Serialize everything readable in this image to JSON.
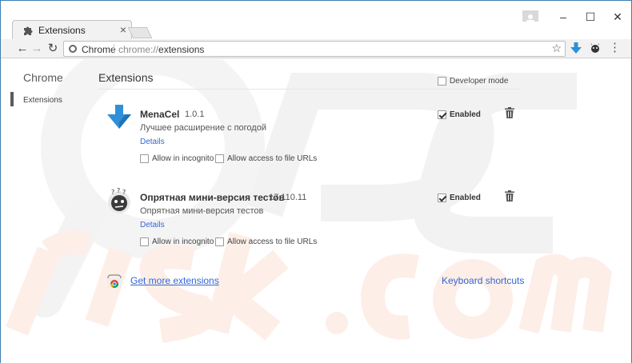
{
  "tab": {
    "title": "Extensions",
    "close": "×"
  },
  "window_controls": {
    "minimize": "–",
    "maximize": "☐",
    "close": "✕"
  },
  "toolbar": {
    "back": "←",
    "forward": "→",
    "reload": "↻",
    "chip_label": "Chrome",
    "url_scheme": "chrome://",
    "url_path": "extensions",
    "star": "☆",
    "menu": "⋮"
  },
  "sidebar": {
    "title": "Chrome",
    "items": [
      {
        "label": "Extensions"
      }
    ]
  },
  "main": {
    "title": "Extensions",
    "developer_mode_label": "Developer mode",
    "developer_mode_checked": false
  },
  "extensions": [
    {
      "name": "MenaCel",
      "version": "1.0.1",
      "description": "Лучшее расширение с погодой",
      "details": "Details",
      "allow_incognito": "Allow in incognito",
      "allow_file_urls": "Allow access to file URLs",
      "enabled_label": "Enabled",
      "enabled": true,
      "icon": "blue-download-arrow-icon"
    },
    {
      "name": "Опрятная мини-версия тестов",
      "version": "17.110.11",
      "description": "Опрятная мини-версия тестов",
      "details": "Details",
      "allow_incognito": "Allow in incognito",
      "allow_file_urls": "Allow access to file URLs",
      "enabled_label": "Enabled",
      "enabled": true,
      "icon": "confused-face-icon"
    }
  ],
  "footer": {
    "get_more": "Get more extensions",
    "keyboard_shortcuts": "Keyboard shortcuts"
  },
  "colors": {
    "link": "#3367d6",
    "accent": "#2f8fd8",
    "frame": "#3c7fb1"
  }
}
